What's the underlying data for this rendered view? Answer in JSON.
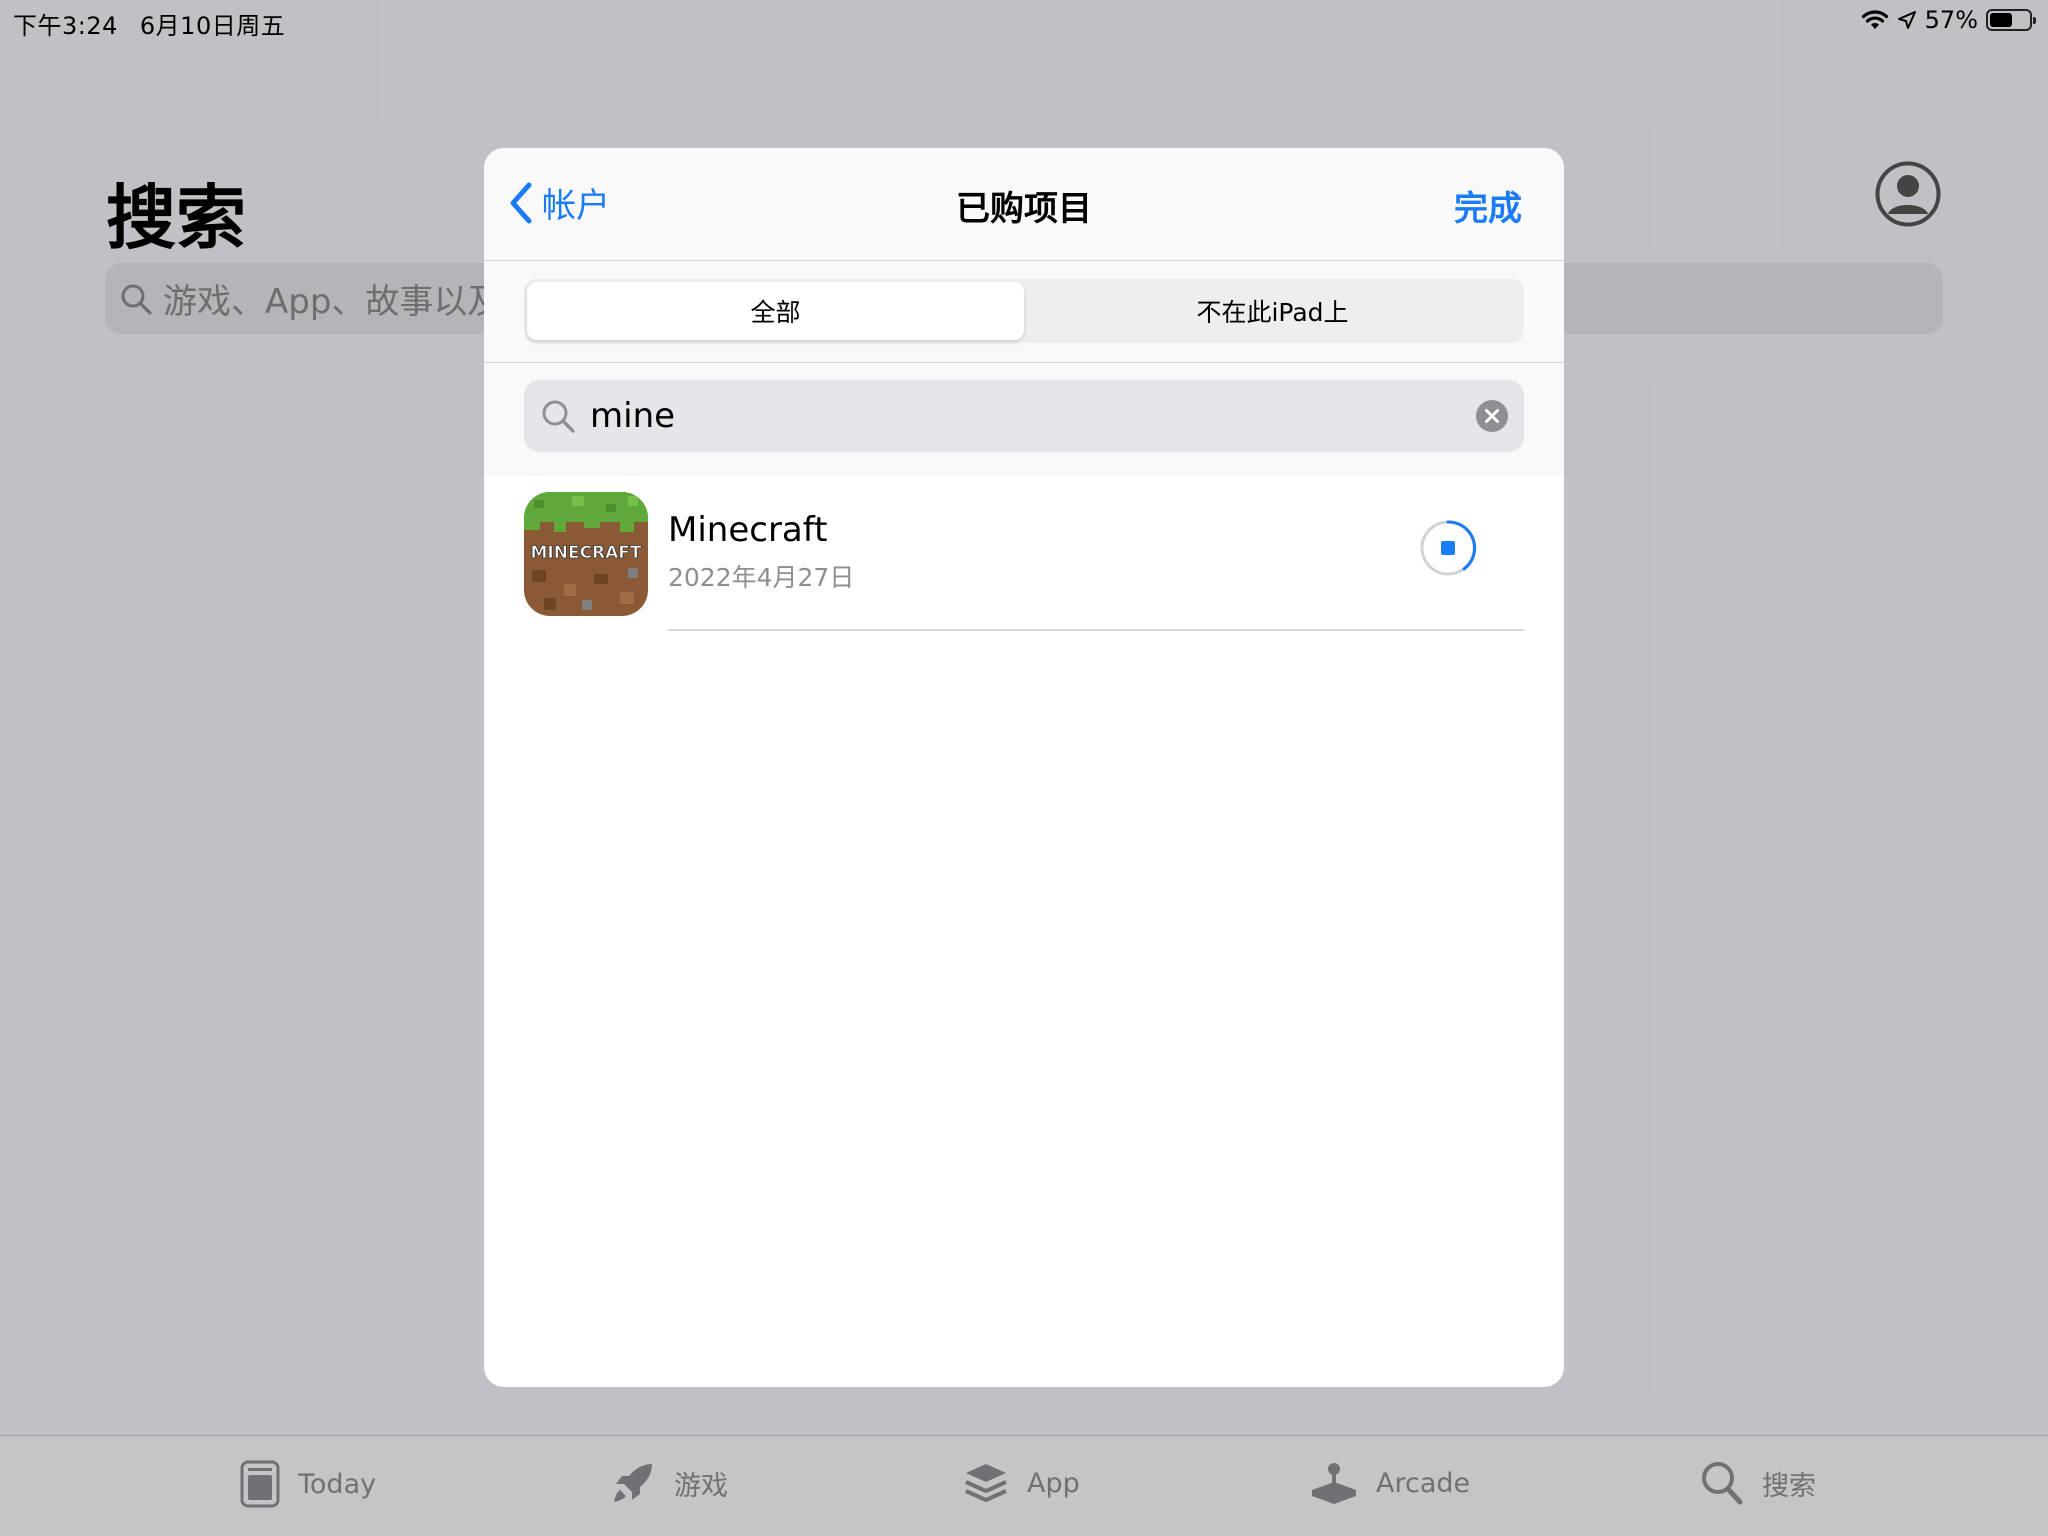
{
  "status_bar": {
    "time": "下午3:24",
    "date": "6月10日周五",
    "battery": "57%",
    "battery_level": 0.57
  },
  "background": {
    "title": "搜索",
    "search_placeholder": "游戏、App、故事以及更多"
  },
  "tab_bar": {
    "items": [
      {
        "label": "Today",
        "icon": "today-icon"
      },
      {
        "label": "游戏",
        "icon": "rocket-icon"
      },
      {
        "label": "App",
        "icon": "app-stack-icon"
      },
      {
        "label": "Arcade",
        "icon": "arcade-joystick-icon"
      },
      {
        "label": "搜索",
        "icon": "search-icon"
      }
    ]
  },
  "modal": {
    "back_label": "帐户",
    "title": "已购项目",
    "done_label": "完成",
    "segments": [
      {
        "label": "全部",
        "selected": true
      },
      {
        "label": "不在此iPad上",
        "selected": false
      }
    ],
    "search_value": "mine",
    "apps": [
      {
        "name": "Minecraft",
        "date": "2022年4月27日",
        "icon_text": "MINECRAFT",
        "status": "downloading-stop"
      }
    ]
  },
  "colors": {
    "accent": "#1a7cf5",
    "secondary_text": "#8e8e93"
  }
}
